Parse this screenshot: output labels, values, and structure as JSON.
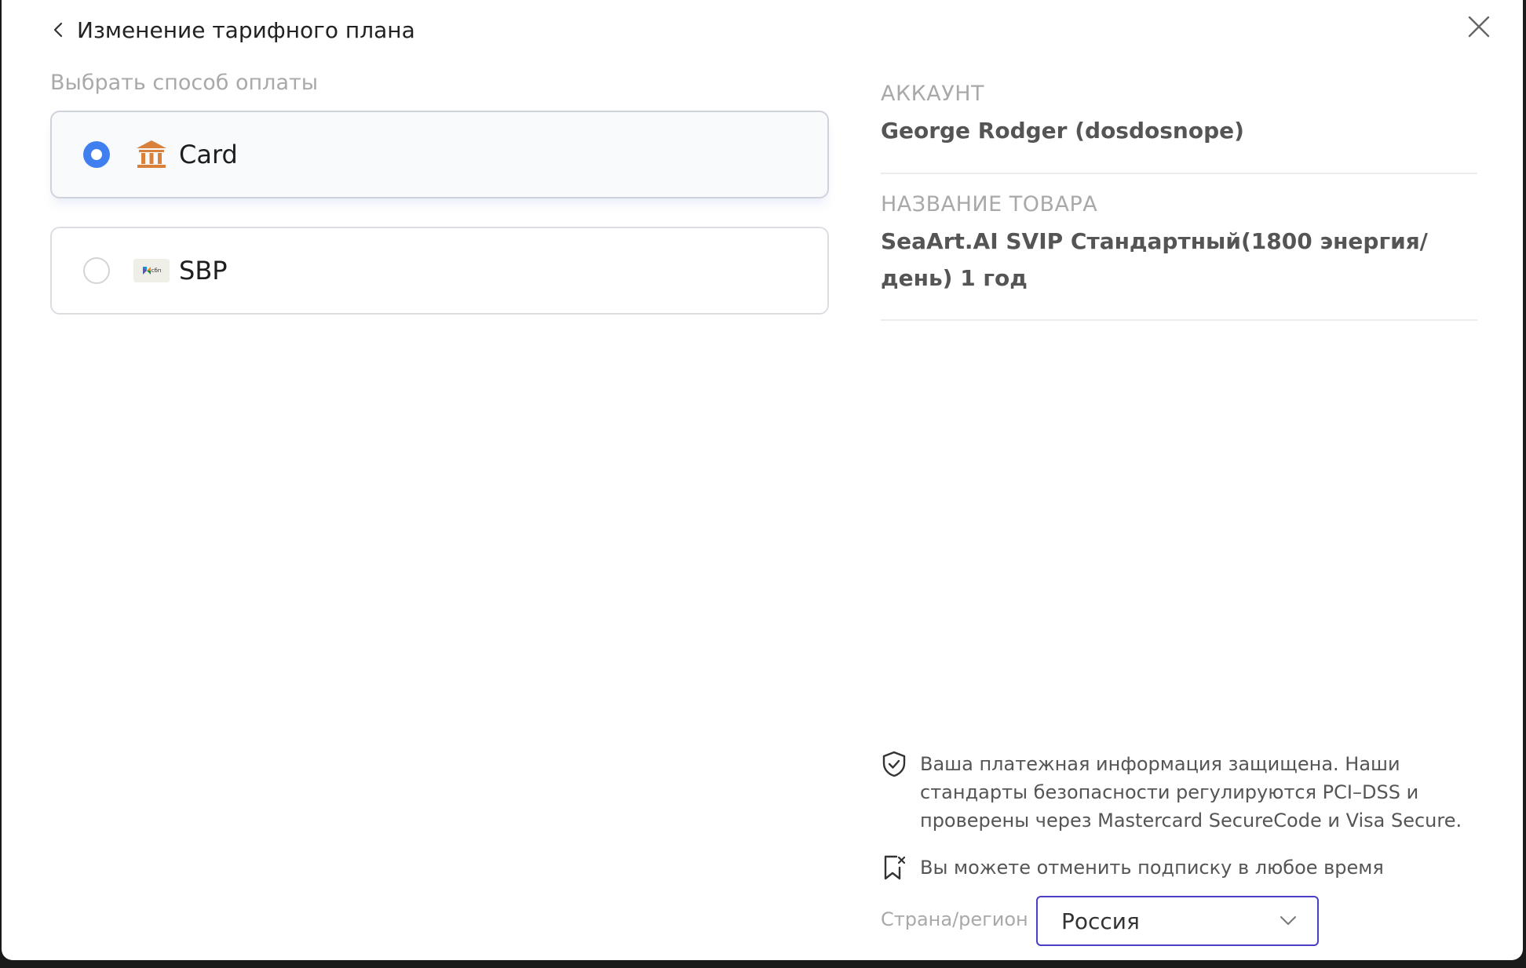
{
  "header": {
    "title": "Изменение тарифного плана"
  },
  "payment": {
    "section_label": "Выбрать способ оплаты",
    "options": [
      {
        "label": "Card",
        "icon": "bank-icon",
        "icon_color": "#d9803a",
        "selected": true
      },
      {
        "label": "SBP",
        "icon": "sbp-logo",
        "logo_text": "сбп",
        "selected": false
      }
    ]
  },
  "order": {
    "account_label": "АККАУНТ",
    "account_value": "George Rodger (dosdosnope)",
    "product_label": "НАЗВАНИЕ ТОВАРА",
    "product_value": "SeaArt.AI SVIP Стандартный(1800 энергия/день) 1 год"
  },
  "notices": {
    "secure_text": "Ваша платежная информация защищена. Наши стандарты безопасности регулируются PCI–DSS и проверены через Mastercard SecureCode и Visa Secure.",
    "cancel_text": "Вы можете отменить подписку в любое время"
  },
  "region": {
    "label": "Страна/регион",
    "value": "Россия"
  },
  "colors": {
    "accent": "#3f7ff0",
    "select_border": "#4a3fc4"
  }
}
